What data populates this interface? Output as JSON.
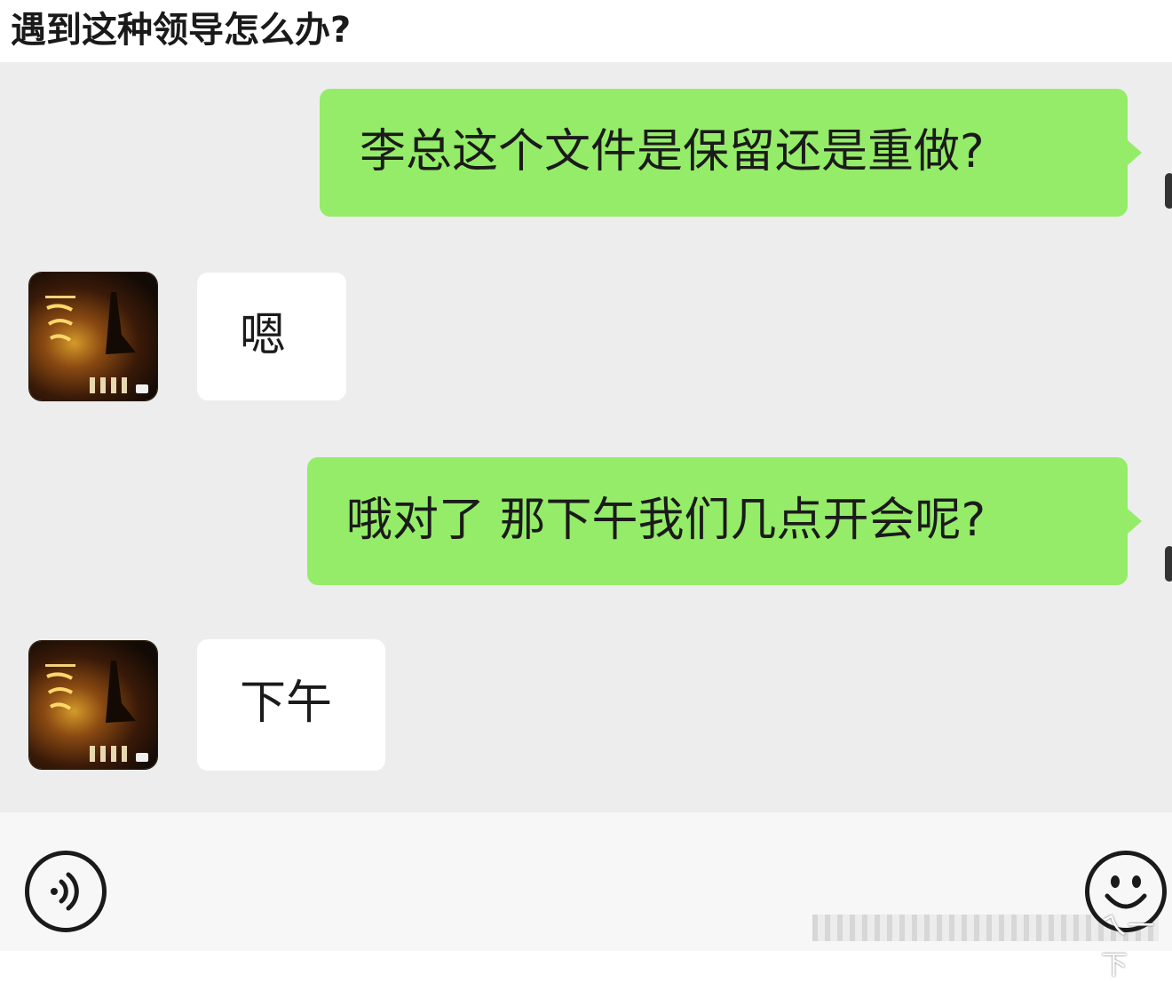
{
  "page": {
    "title": "遇到这种领导怎么办?"
  },
  "chat": {
    "messages": [
      {
        "side": "sent",
        "text": "李总这个文件是保留还是重做?"
      },
      {
        "side": "received",
        "text": "嗯"
      },
      {
        "side": "sent",
        "text": "哦对了 那下午我们几点开会呢?"
      },
      {
        "side": "received",
        "text": "下午"
      }
    ]
  },
  "input_bar": {
    "voice_icon": "voice-icon",
    "emoji_icon": "emoji-icon"
  },
  "watermark": {
    "text": "ㄟ一下"
  },
  "colors": {
    "sent_bubble": "#95ec69",
    "received_bubble": "#ffffff",
    "chat_background": "#ededed"
  }
}
